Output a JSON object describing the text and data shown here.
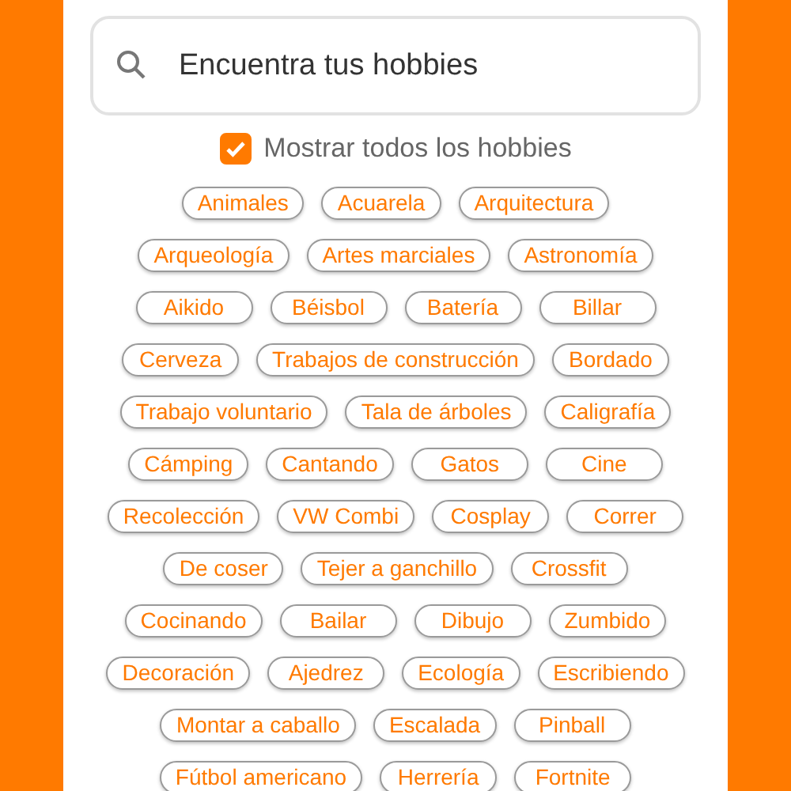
{
  "search": {
    "placeholder": "Encuentra tus hobbies"
  },
  "show_all": {
    "label": "Mostrar todos los hobbies",
    "checked": true
  },
  "hobby_rows": [
    [
      "Animales",
      "Acuarela",
      "Arquitectura"
    ],
    [
      "Arqueología",
      "Artes marciales",
      "Astronomía"
    ],
    [
      "Aikido",
      "Béisbol",
      "Batería",
      "Billar"
    ],
    [
      "Cerveza",
      "Trabajos de construcción",
      "Bordado"
    ],
    [
      "Trabajo voluntario",
      "Tala de árboles",
      "Caligrafía"
    ],
    [
      "Cámping",
      "Cantando",
      "Gatos",
      "Cine"
    ],
    [
      "Recolección",
      "VW Combi",
      "Cosplay",
      "Correr"
    ],
    [
      "De coser",
      "Tejer a ganchillo",
      "Crossfit"
    ],
    [
      "Cocinando",
      "Bailar",
      "Dibujo",
      "Zumbido"
    ],
    [
      "Decoración",
      "Ajedrez",
      "Ecología",
      "Escribiendo"
    ],
    [
      "Montar a caballo",
      "Escalada",
      "Pinball"
    ],
    [
      "Fútbol americano",
      "Herrería",
      "Fortnite"
    ]
  ]
}
